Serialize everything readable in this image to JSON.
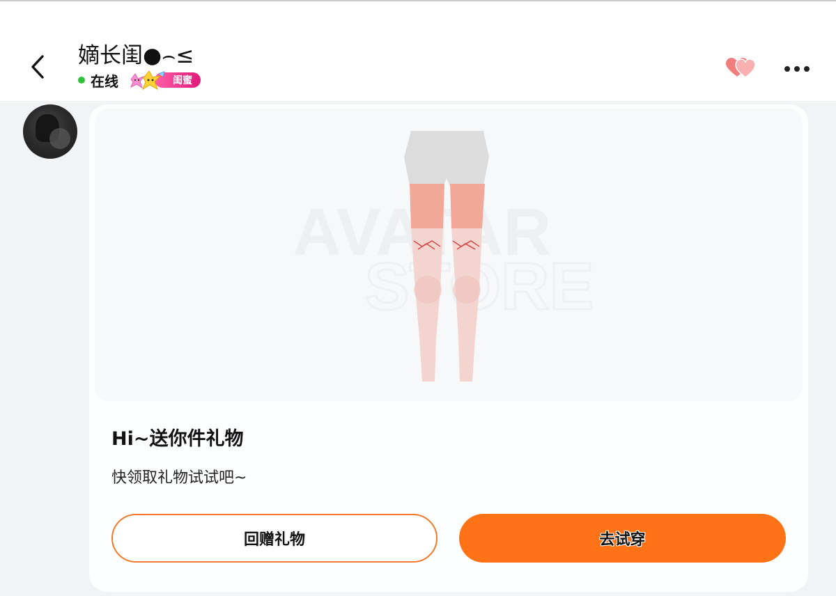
{
  "header": {
    "title": "嫡长闺●⌢≤",
    "status_text": "在线",
    "badge_text": "闺蜜",
    "icons": {
      "back": "chevron-left-icon",
      "hearts": "double-heart-icon",
      "more": "more-dots-icon"
    },
    "colors": {
      "online": "#33c23f",
      "badge": "#e0197a",
      "hearts": "#f27d7d"
    }
  },
  "message": {
    "image_alt": "thigh-high stockings product preview",
    "watermark_line1": "AVATAR",
    "watermark_line2": "STORE",
    "title": "Hi~送你件礼物",
    "subtitle": "快领取礼物试试吧~",
    "buttons": {
      "return_gift": "回赠礼物",
      "try_on": "去试穿"
    },
    "colors": {
      "accent": "#ff7316"
    }
  }
}
